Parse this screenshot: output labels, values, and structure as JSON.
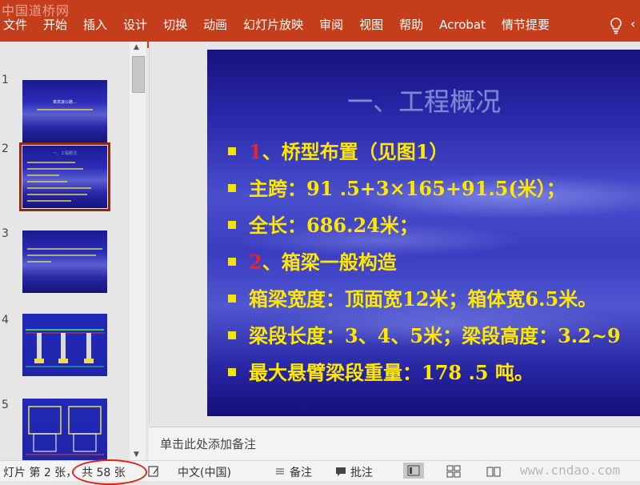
{
  "watermark_top": "中国道桥网",
  "ribbon": {
    "tabs": [
      "文件",
      "开始",
      "插入",
      "设计",
      "切换",
      "动画",
      "幻灯片放映",
      "审阅",
      "视图",
      "帮助",
      "Acrobat",
      "情节提要"
    ]
  },
  "thumbnails": [
    {
      "num": "1",
      "title": "某高速公路…",
      "selected": false
    },
    {
      "num": "2",
      "title": "一、工程概况",
      "selected": true
    },
    {
      "num": "3",
      "title": "",
      "selected": false
    },
    {
      "num": "4",
      "title": "",
      "selected": false
    },
    {
      "num": "5",
      "title": "",
      "selected": false
    }
  ],
  "slide": {
    "title": "一、工程概况",
    "bullets": [
      {
        "red": "1",
        "text": "、桥型布置（见图1）"
      },
      {
        "red": "",
        "text": "主跨：91 .5+3×165+91.5(米）；"
      },
      {
        "red": "",
        "text": "全长：686.24米；"
      },
      {
        "red": "2",
        "text": "、箱梁一般构造"
      },
      {
        "red": "",
        "text": "箱梁宽度：顶面宽12米；箱体宽6.5米。"
      },
      {
        "red": "",
        "text": "梁段长度：3、4、5米；梁段高度：3.2~9"
      },
      {
        "red": "",
        "text": "最大悬臂梁段重量：178 .5 吨。"
      }
    ]
  },
  "notes_placeholder": "单击此处添加备注",
  "status": {
    "slide_position": "幻灯片 第 2 张，共 58 张",
    "slide_position_visible": "灯片 第 2 张，",
    "slide_total": "共 58 张",
    "language": "中文(中国)",
    "notes": "备注",
    "comments": "批注"
  },
  "watermark_bottom": "www.cndao.com",
  "colors": {
    "ribbon": "#c43e1c",
    "bullet_text": "#ffe800",
    "number_red": "#e8252a",
    "circle": "#e0201c"
  }
}
